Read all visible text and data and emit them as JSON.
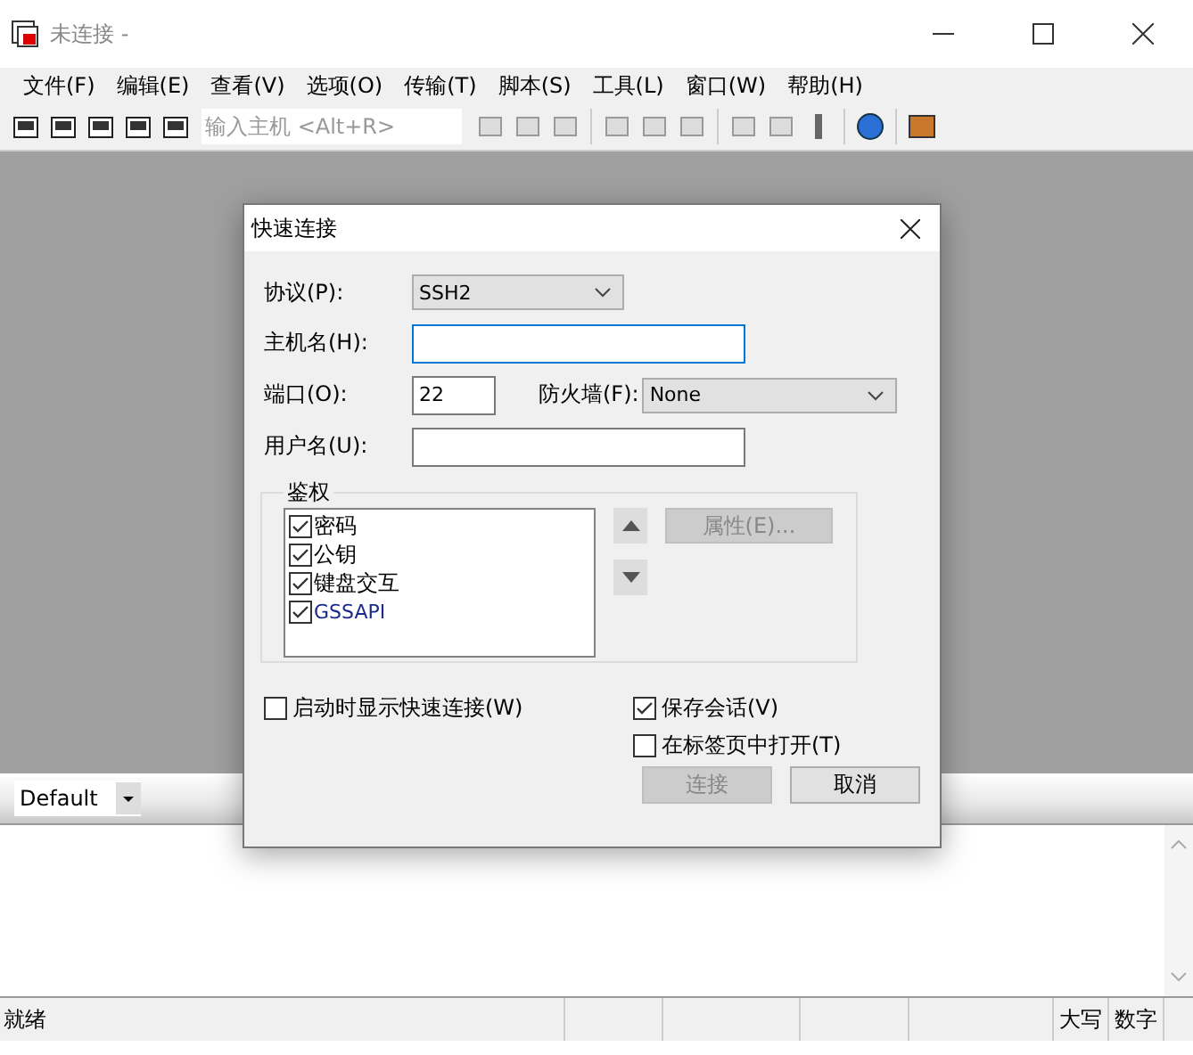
{
  "window": {
    "title": "未连接 -"
  },
  "menu": [
    "文件(F)",
    "编辑(E)",
    "查看(V)",
    "选项(O)",
    "传输(T)",
    "脚本(S)",
    "工具(L)",
    "窗口(W)",
    "帮助(H)"
  ],
  "toolbar": {
    "host_field": {
      "placeholder": "输入主机 <Alt+R>"
    }
  },
  "session_bar": {
    "session": "Default"
  },
  "status_bar": {
    "message": "就绪",
    "indicators": [
      "大写",
      "数字"
    ]
  },
  "dialog": {
    "title": "快速连接",
    "protocol": {
      "label": "协议(P):",
      "value": "SSH2"
    },
    "hostname": {
      "label": "主机名(H):",
      "focused": true
    },
    "port": {
      "label": "端口(O):",
      "value": "22"
    },
    "firewall": {
      "label": "防火墙(F):",
      "value": "None"
    },
    "username": {
      "label": "用户名(U):"
    },
    "auth": {
      "title": "鉴权",
      "methods": [
        {
          "label": "密码",
          "checked": true
        },
        {
          "label": "公钥",
          "checked": true
        },
        {
          "label": "键盘交互",
          "checked": true
        },
        {
          "label": "GSSAPI",
          "checked": true
        }
      ],
      "properties_button": {
        "label": "属性(E)...",
        "disabled": true
      }
    },
    "options": [
      {
        "label": "启动时显示快速连接(W)",
        "checked": false
      },
      {
        "label": "保存会话(V)",
        "checked": true
      },
      {
        "label": "在标签页中打开(T)",
        "checked": false
      }
    ],
    "buttons": [
      {
        "label": "连接",
        "disabled": true
      },
      {
        "label": "取消",
        "disabled": false
      }
    ]
  }
}
